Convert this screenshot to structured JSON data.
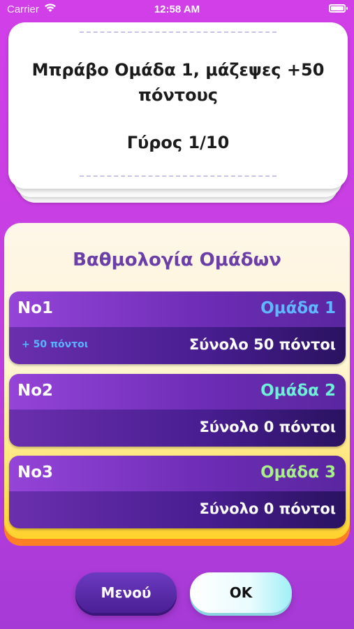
{
  "status_bar": {
    "carrier": "Carrier",
    "time": "12:58 AM"
  },
  "round_card": {
    "message": "Μπράβο Ομάδα 1, μάζεψες +50 πόντους",
    "round": "Γύρος 1/10"
  },
  "scoreboard": {
    "title": "Βαθμολογία Ομάδων",
    "teams": [
      {
        "rank": "No1",
        "name": "Ομάδα 1",
        "name_color": "#5fb8ff",
        "added": "+ 50 πόντοι",
        "total": "Σύνολο 50 πόντοι"
      },
      {
        "rank": "No2",
        "name": "Ομάδα 2",
        "name_color": "#6ef0d8",
        "added": "",
        "total": "Σύνολο 0 πόντοι"
      },
      {
        "rank": "No3",
        "name": "Ομάδα 3",
        "name_color": "#a8f08a",
        "added": "",
        "total": "Σύνολο 0 πόντοι"
      }
    ]
  },
  "buttons": {
    "menu_label": "Μενού",
    "ok_label": "OK"
  }
}
